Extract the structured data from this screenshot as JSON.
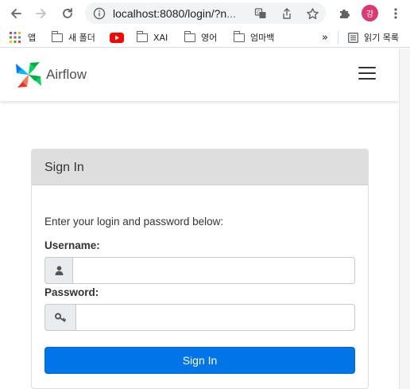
{
  "browser": {
    "url_main": "localhost:8080/login/?n",
    "url_tail": "...",
    "profile_initial": "강"
  },
  "bookmarks": {
    "items": [
      {
        "label": "앱",
        "icon": "apps-grid-icon"
      },
      {
        "label": "새 폴더",
        "icon": "folder-icon"
      },
      {
        "label": "",
        "icon": "youtube-icon"
      },
      {
        "label": "XAI",
        "icon": "folder-icon"
      },
      {
        "label": "영어",
        "icon": "folder-icon"
      },
      {
        "label": "엄마백",
        "icon": "folder-icon"
      }
    ],
    "overflow": "»",
    "reading_list": "읽기 목록"
  },
  "app": {
    "brand": "Airflow"
  },
  "login": {
    "title": "Sign In",
    "intro": "Enter your login and password below:",
    "username_label": "Username:",
    "username_value": "",
    "password_label": "Password:",
    "password_value": "",
    "submit_label": "Sign In"
  },
  "colors": {
    "primary_button": "#0075e8",
    "panel_header": "#dedede",
    "youtube_red": "#ff0000"
  }
}
